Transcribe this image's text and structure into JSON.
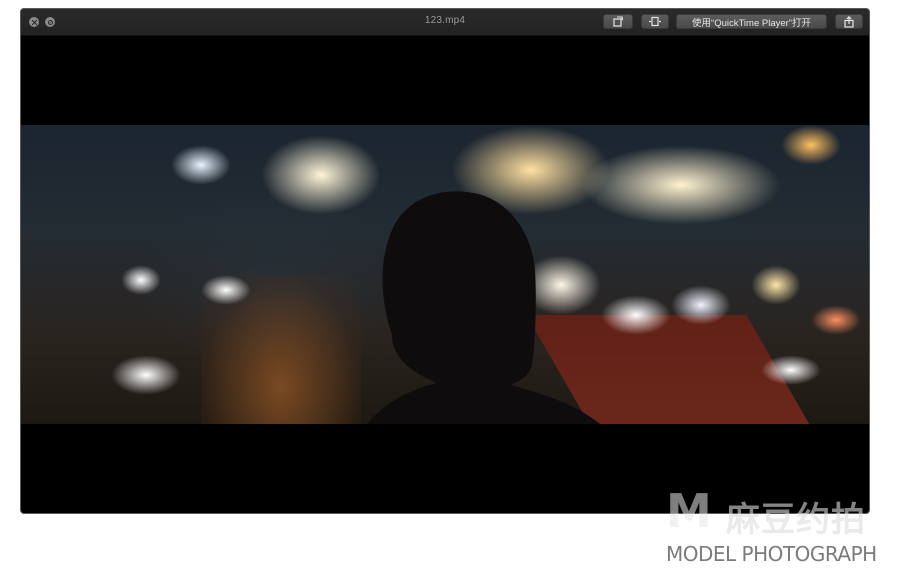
{
  "window": {
    "title": "123.mp4",
    "open_with_label": "使用“QuickTime Player”打开",
    "buttons": {
      "close": "close-icon",
      "fullscreen": "fullscreen-icon",
      "rotate": "rotate-icon",
      "trim": "trim-icon",
      "share": "share-icon"
    }
  },
  "watermark": {
    "logo": "M",
    "chinese": "麻豆约拍",
    "english": "MODEL PHOTOGRAPH"
  },
  "colors": {
    "background": "#000000",
    "titlebar": "#262626",
    "button": "#525252"
  }
}
